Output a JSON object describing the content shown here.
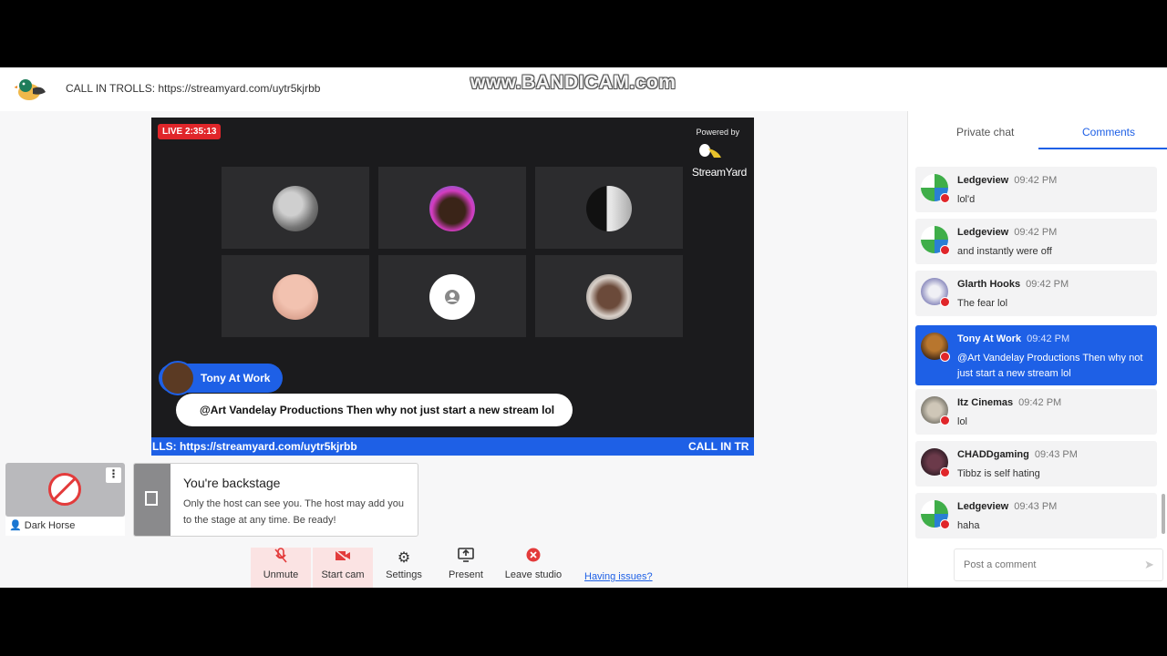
{
  "header": {
    "call_in": "CALL IN TROLLS: https://streamyard.com/uytr5kjrbb",
    "watermark": "www.BANDICAM.com"
  },
  "stage": {
    "live_badge": "LIVE 2:35:13",
    "powered_by": "Powered by",
    "brand": "StreamYard",
    "participant_count": 6,
    "featured_comment": {
      "author": "Tony At Work",
      "text": "@Art Vandelay Productions Then why not just start a new stream lol"
    },
    "ticker_left": "LLS: https://streamyard.com/uytr5kjrbb",
    "ticker_right": "CALL IN TR"
  },
  "backstage": {
    "name": "Dark Horse",
    "notice_title": "You're backstage",
    "notice_body": "Only the host can see you. The host may add you to the stage at any time. Be ready!"
  },
  "controls": {
    "unmute": "Unmute",
    "start_cam": "Start cam",
    "settings": "Settings",
    "present": "Present",
    "leave": "Leave studio",
    "issues": "Having issues?"
  },
  "chat": {
    "tab_private": "Private chat",
    "tab_comments": "Comments",
    "comments": [
      {
        "author": "Ledgeview",
        "time": "09:42 PM",
        "text": "lol'd"
      },
      {
        "author": "Ledgeview",
        "time": "09:42 PM",
        "text": "and instantly were off"
      },
      {
        "author": "Glarth Hooks",
        "time": "09:42 PM",
        "text": "The fear lol"
      },
      {
        "author": "Tony At Work",
        "time": "09:42 PM",
        "text": "@Art Vandelay Productions Then why not just start a new stream lol"
      },
      {
        "author": "Itz Cinemas",
        "time": "09:42 PM",
        "text": "lol"
      },
      {
        "author": "CHADDgaming",
        "time": "09:43 PM",
        "text": "Tibbz is self hating"
      },
      {
        "author": "Ledgeview",
        "time": "09:43 PM",
        "text": "haha"
      }
    ],
    "input_placeholder": "Post a comment",
    "colors": {
      "accent": "#1e60e6",
      "live_red": "#e0262a"
    }
  }
}
